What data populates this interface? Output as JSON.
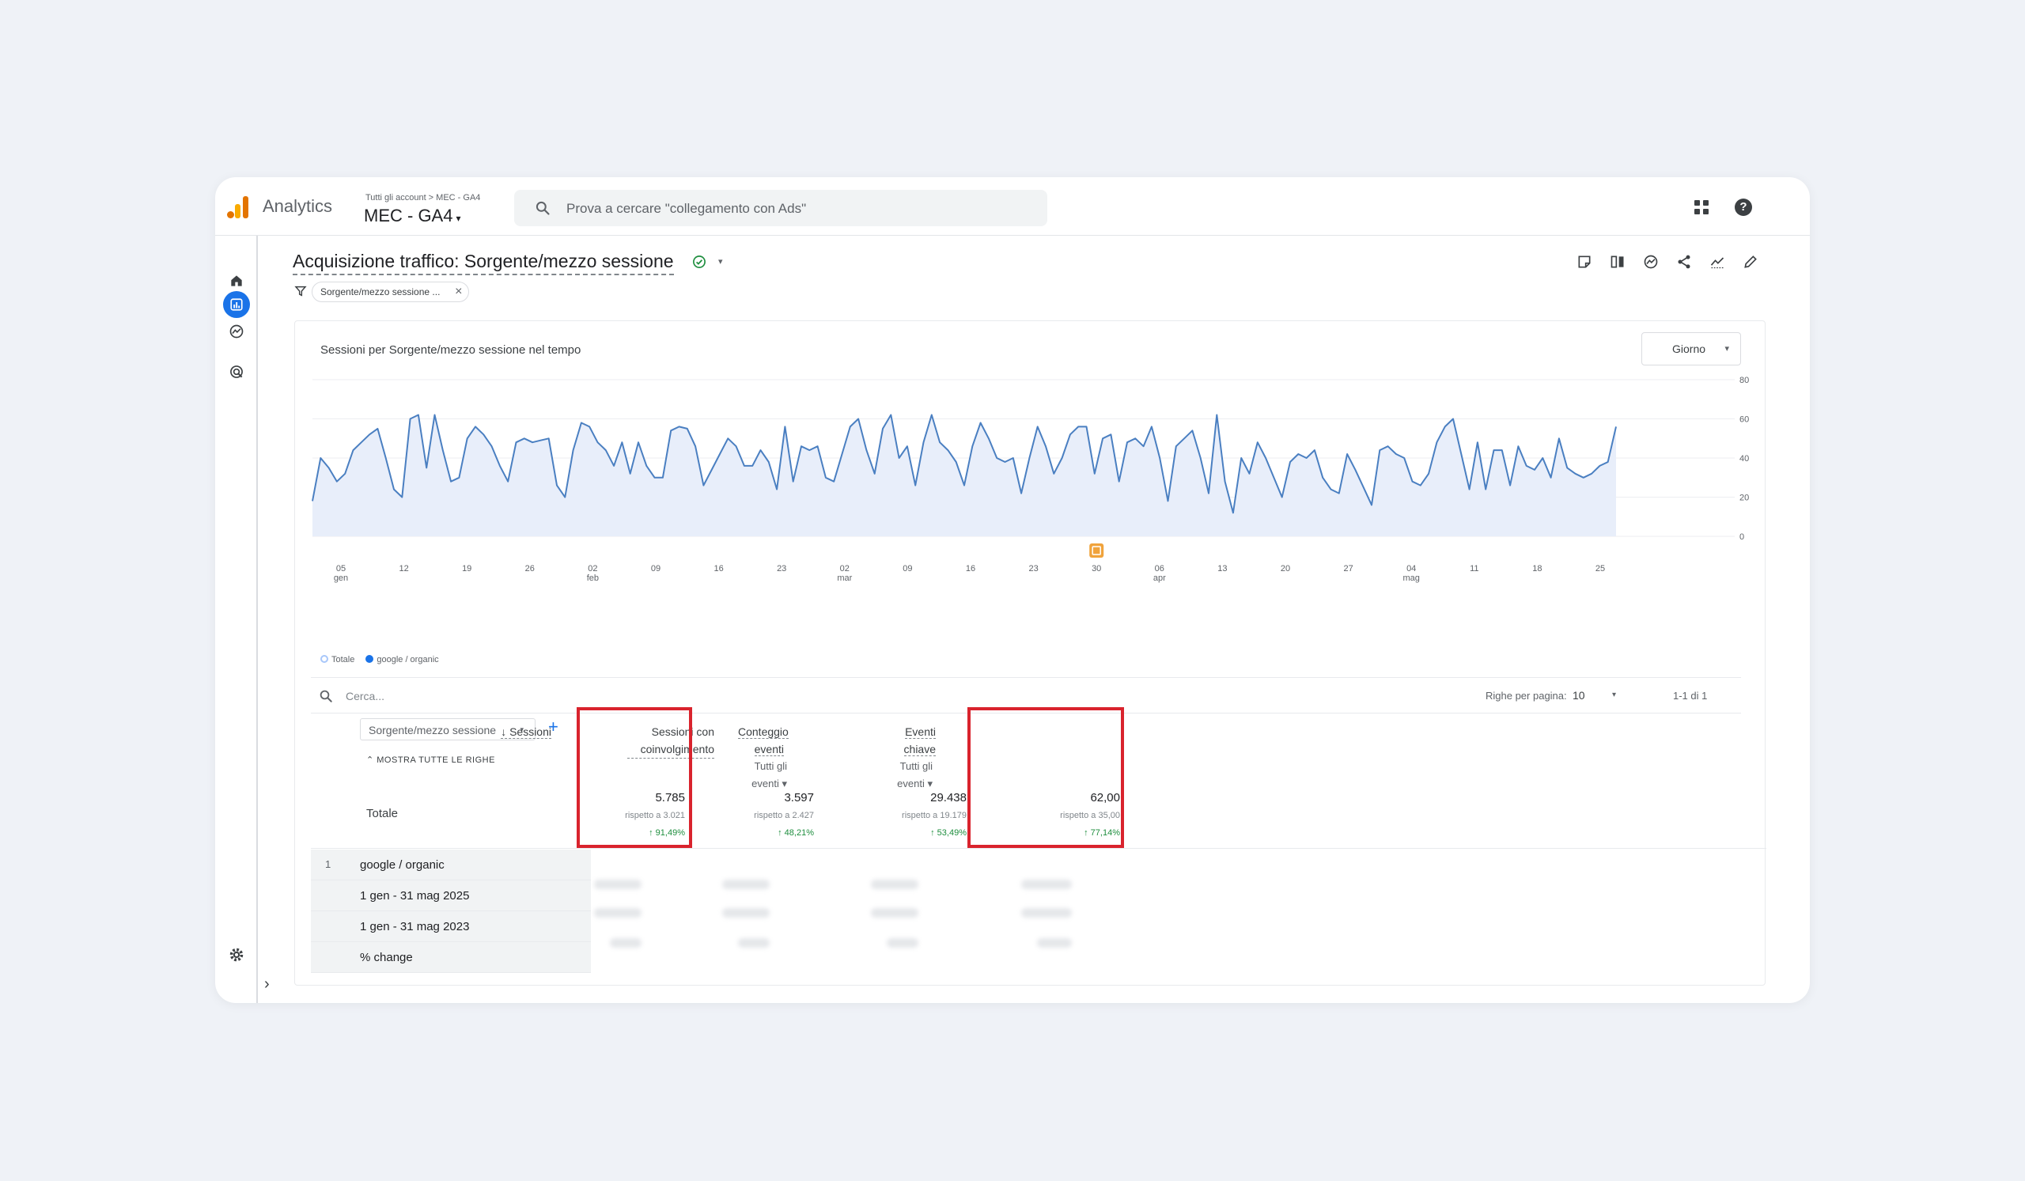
{
  "app": {
    "name": "Analytics",
    "breadcrumb": "Tutti gli account > MEC - GA4",
    "property": "MEC - GA4",
    "property_caret": "▾"
  },
  "search": {
    "placeholder": "Prova a cercare \"collegamento con Ads\""
  },
  "help_glyph": "?",
  "page": {
    "title": "Acquisizione traffico: Sorgente/mezzo sessione",
    "title_caret": "▾"
  },
  "filter_chip": {
    "label": "Sorgente/mezzo sessione ...",
    "close": "×"
  },
  "toolbar_icons": [
    "annotation-icon",
    "compare-icon",
    "insights-icon",
    "share-icon",
    "trend-icon",
    "edit-icon"
  ],
  "rail_icons": [
    "home-icon",
    "reports-icon",
    "explore-icon",
    "advertising-icon",
    "settings-icon"
  ],
  "rail_expand": "›",
  "chart": {
    "title": "Sessioni per Sorgente/mezzo sessione nel tempo",
    "granularity": "Giorno",
    "granularity_caret": "▾",
    "legend": [
      {
        "label": "Totale",
        "color": "#a8c7fa"
      },
      {
        "label": "google / organic",
        "color": "#1a73e8"
      }
    ]
  },
  "chart_data": {
    "type": "area",
    "x_ticks": [
      {
        "d": "05",
        "m": "gen"
      },
      {
        "d": "12",
        "m": ""
      },
      {
        "d": "19",
        "m": ""
      },
      {
        "d": "26",
        "m": ""
      },
      {
        "d": "02",
        "m": "feb"
      },
      {
        "d": "09",
        "m": ""
      },
      {
        "d": "16",
        "m": ""
      },
      {
        "d": "23",
        "m": ""
      },
      {
        "d": "02",
        "m": "mar"
      },
      {
        "d": "09",
        "m": ""
      },
      {
        "d": "16",
        "m": ""
      },
      {
        "d": "23",
        "m": ""
      },
      {
        "d": "30",
        "m": ""
      },
      {
        "d": "06",
        "m": "apr"
      },
      {
        "d": "13",
        "m": ""
      },
      {
        "d": "20",
        "m": ""
      },
      {
        "d": "27",
        "m": ""
      },
      {
        "d": "04",
        "m": "mag"
      },
      {
        "d": "11",
        "m": ""
      },
      {
        "d": "18",
        "m": ""
      },
      {
        "d": "25",
        "m": ""
      }
    ],
    "y_ticks": [
      "80",
      "60",
      "40",
      "20",
      "0"
    ],
    "ylim": [
      0,
      80
    ],
    "series": [
      {
        "name": "google / organic",
        "color": "#4a7fc1",
        "values": [
          18,
          40,
          35,
          28,
          32,
          44,
          48,
          52,
          55,
          40,
          24,
          20,
          60,
          62,
          35,
          62,
          44,
          28,
          30,
          50,
          56,
          52,
          46,
          36,
          28,
          48,
          50,
          48,
          49,
          50,
          26,
          20,
          44,
          58,
          56,
          48,
          44,
          36,
          48,
          32,
          48,
          36,
          30,
          30,
          54,
          56,
          55,
          46,
          26,
          34,
          42,
          50,
          46,
          36,
          36,
          44,
          38,
          24,
          56,
          28,
          46,
          44,
          46,
          30,
          28,
          42,
          56,
          60,
          44,
          32,
          55,
          62,
          40,
          46,
          26,
          48,
          62,
          48,
          44,
          38,
          26,
          46,
          58,
          50,
          40,
          38,
          40,
          22,
          40,
          56,
          46,
          32,
          40,
          52,
          56,
          56,
          32,
          50,
          52,
          28,
          48,
          50,
          46,
          56,
          40,
          18,
          46,
          50,
          54,
          40,
          22,
          62,
          28,
          12,
          40,
          32,
          48,
          40,
          30,
          20,
          38,
          42,
          40,
          44,
          30,
          24,
          22,
          42,
          34,
          25,
          16,
          44,
          46,
          42,
          40,
          28,
          26,
          32,
          48,
          56,
          60,
          42,
          24,
          48,
          24,
          44,
          44,
          26,
          46,
          36,
          34,
          40,
          30,
          50,
          35,
          32,
          30,
          32,
          36,
          38,
          56
        ]
      }
    ],
    "annotation_marker": "30 mar"
  },
  "table": {
    "search_placeholder": "Cerca...",
    "rows_per_page_label": "Righe per pagina:",
    "rows_per_page": "10",
    "rows_caret": "▾",
    "pagination": "1-1 di 1",
    "dimension": "Sorgente/mezzo sessione",
    "dimension_caret": "▾",
    "add_dimension": "+",
    "show_all": "⌃ MOSTRA TUTTE LE RIGHE",
    "totals_label": "Totale",
    "columns": [
      {
        "label": "↓ Sessioni",
        "sub": "",
        "total": "5.785",
        "compare": "rispetto a 3.021",
        "change": "↑ 91,49%"
      },
      {
        "label": "Sessioni con coinvolgimento",
        "sub": "",
        "total": "3.597",
        "compare": "rispetto a 2.427",
        "change": "↑ 48,21%"
      },
      {
        "label": "Conteggio eventi",
        "sub": "Tutti gli eventi ▾",
        "total": "29.438",
        "compare": "rispetto a 19.179",
        "change": "↑ 53,49%"
      },
      {
        "label": "Eventi chiave",
        "sub": "Tutti gli eventi ▾",
        "total": "62,00",
        "compare": "rispetto a 35,00",
        "change": "↑ 77,14%"
      }
    ],
    "rows": [
      {
        "num": "1",
        "label": "google / organic"
      },
      {
        "num": "",
        "label": "1 gen - 31 mag 2025"
      },
      {
        "num": "",
        "label": "1 gen - 31 mag 2023"
      },
      {
        "num": "",
        "label": "% change"
      }
    ]
  },
  "highlight_color": "#d9232d"
}
